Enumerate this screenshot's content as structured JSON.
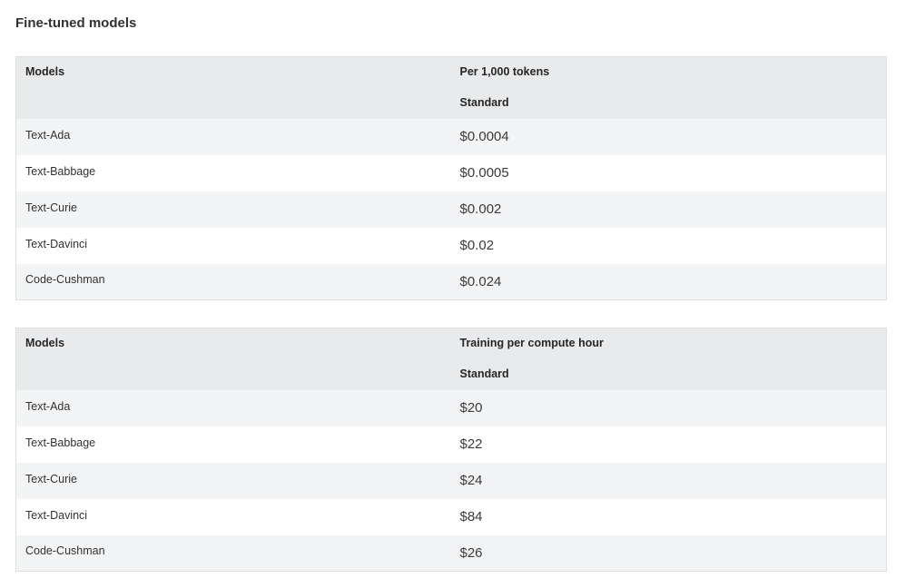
{
  "section": {
    "title": "Fine-tuned models"
  },
  "usage_table": {
    "model_header": "Models",
    "price_header": "Per 1,000 tokens",
    "tier_header": "Standard",
    "rows": [
      {
        "model": "Text-Ada",
        "price": "$0.0004"
      },
      {
        "model": "Text-Babbage",
        "price": "$0.0005"
      },
      {
        "model": "Text-Curie",
        "price": "$0.002"
      },
      {
        "model": "Text-Davinci",
        "price": "$0.02"
      },
      {
        "model": "Code-Cushman",
        "price": "$0.024"
      }
    ]
  },
  "training_table": {
    "model_header": "Models",
    "price_header": "Training per compute hour",
    "tier_header": "Standard",
    "rows": [
      {
        "model": "Text-Ada",
        "price": "$20"
      },
      {
        "model": "Text-Babbage",
        "price": "$22"
      },
      {
        "model": "Text-Curie",
        "price": "$24"
      },
      {
        "model": "Text-Davinci",
        "price": "$84"
      },
      {
        "model": "Code-Cushman",
        "price": "$26"
      }
    ]
  }
}
